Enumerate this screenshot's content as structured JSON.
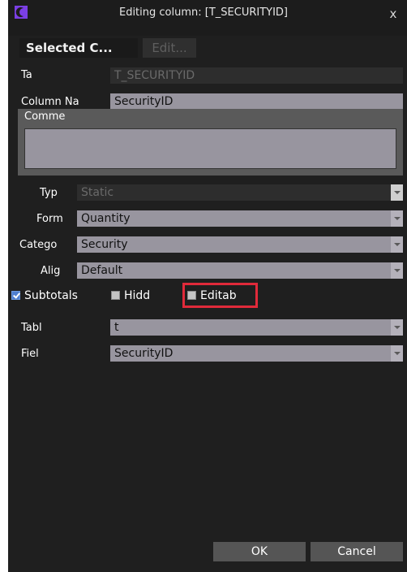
{
  "window": {
    "title": "Editing column: [T_SECURITYID]",
    "close_glyph": "x"
  },
  "tabs": {
    "selected": "Selected C...",
    "edit": "Edit..."
  },
  "fields": {
    "table_label": "Ta",
    "table_value": "T_SECURITYID",
    "column_name_label": "Column Na",
    "column_name_value": "SecurityID",
    "comment_label": "Comme",
    "comment_value": ""
  },
  "dropdowns": {
    "type": {
      "label": "Typ",
      "value": "Static"
    },
    "format": {
      "label": "Form",
      "value": "Quantity"
    },
    "category": {
      "label": "Catego",
      "value": "Security"
    },
    "align": {
      "label": "Alig",
      "value": "Default"
    },
    "table": {
      "label": "Tabl",
      "value": "t"
    },
    "field": {
      "label": "Fiel",
      "value": "SecurityID"
    }
  },
  "checkboxes": {
    "subtotals": {
      "label": "Subtotals",
      "checked": true
    },
    "hidden": {
      "label": "Hidd",
      "checked": false
    },
    "editable": {
      "label": "Editab",
      "checked": false
    }
  },
  "buttons": {
    "ok": "OK",
    "cancel": "Cancel"
  },
  "colors": {
    "accent": "#7b3fe4",
    "highlight": "#e02a3a",
    "field_bg": "#98959f",
    "dialog_bg": "#1f1f1f"
  }
}
